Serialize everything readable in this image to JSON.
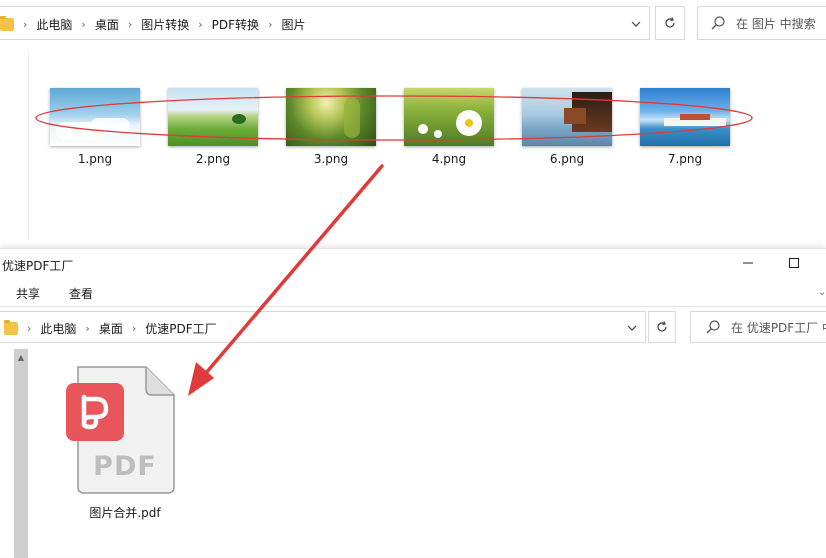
{
  "top_window": {
    "breadcrumb": [
      "此电脑",
      "桌面",
      "图片转换",
      "PDF转换",
      "图片"
    ],
    "search_placeholder": "在 图片 中搜索",
    "files": [
      {
        "name": "1.png",
        "thumb": "sky-clouds"
      },
      {
        "name": "2.png",
        "thumb": "green-meadow"
      },
      {
        "name": "3.png",
        "thumb": "forest-light"
      },
      {
        "name": "4.png",
        "thumb": "daisy-field"
      },
      {
        "name": "6.png",
        "thumb": "lake-house"
      },
      {
        "name": "7.png",
        "thumb": "harbor-town"
      }
    ]
  },
  "bottom_window": {
    "title": "优速PDF工厂",
    "ribbon_tabs": [
      "共享",
      "查看"
    ],
    "breadcrumb": [
      "此电脑",
      "桌面",
      "优速PDF工厂"
    ],
    "search_placeholder": "在 优速PDF工厂 中",
    "file": {
      "name": "图片合并.pdf",
      "type_label": "PDF"
    }
  },
  "colors": {
    "annotation_red": "#e03a3a",
    "pdf_red": "#e8555b",
    "folder_yellow": "#f5c342"
  }
}
